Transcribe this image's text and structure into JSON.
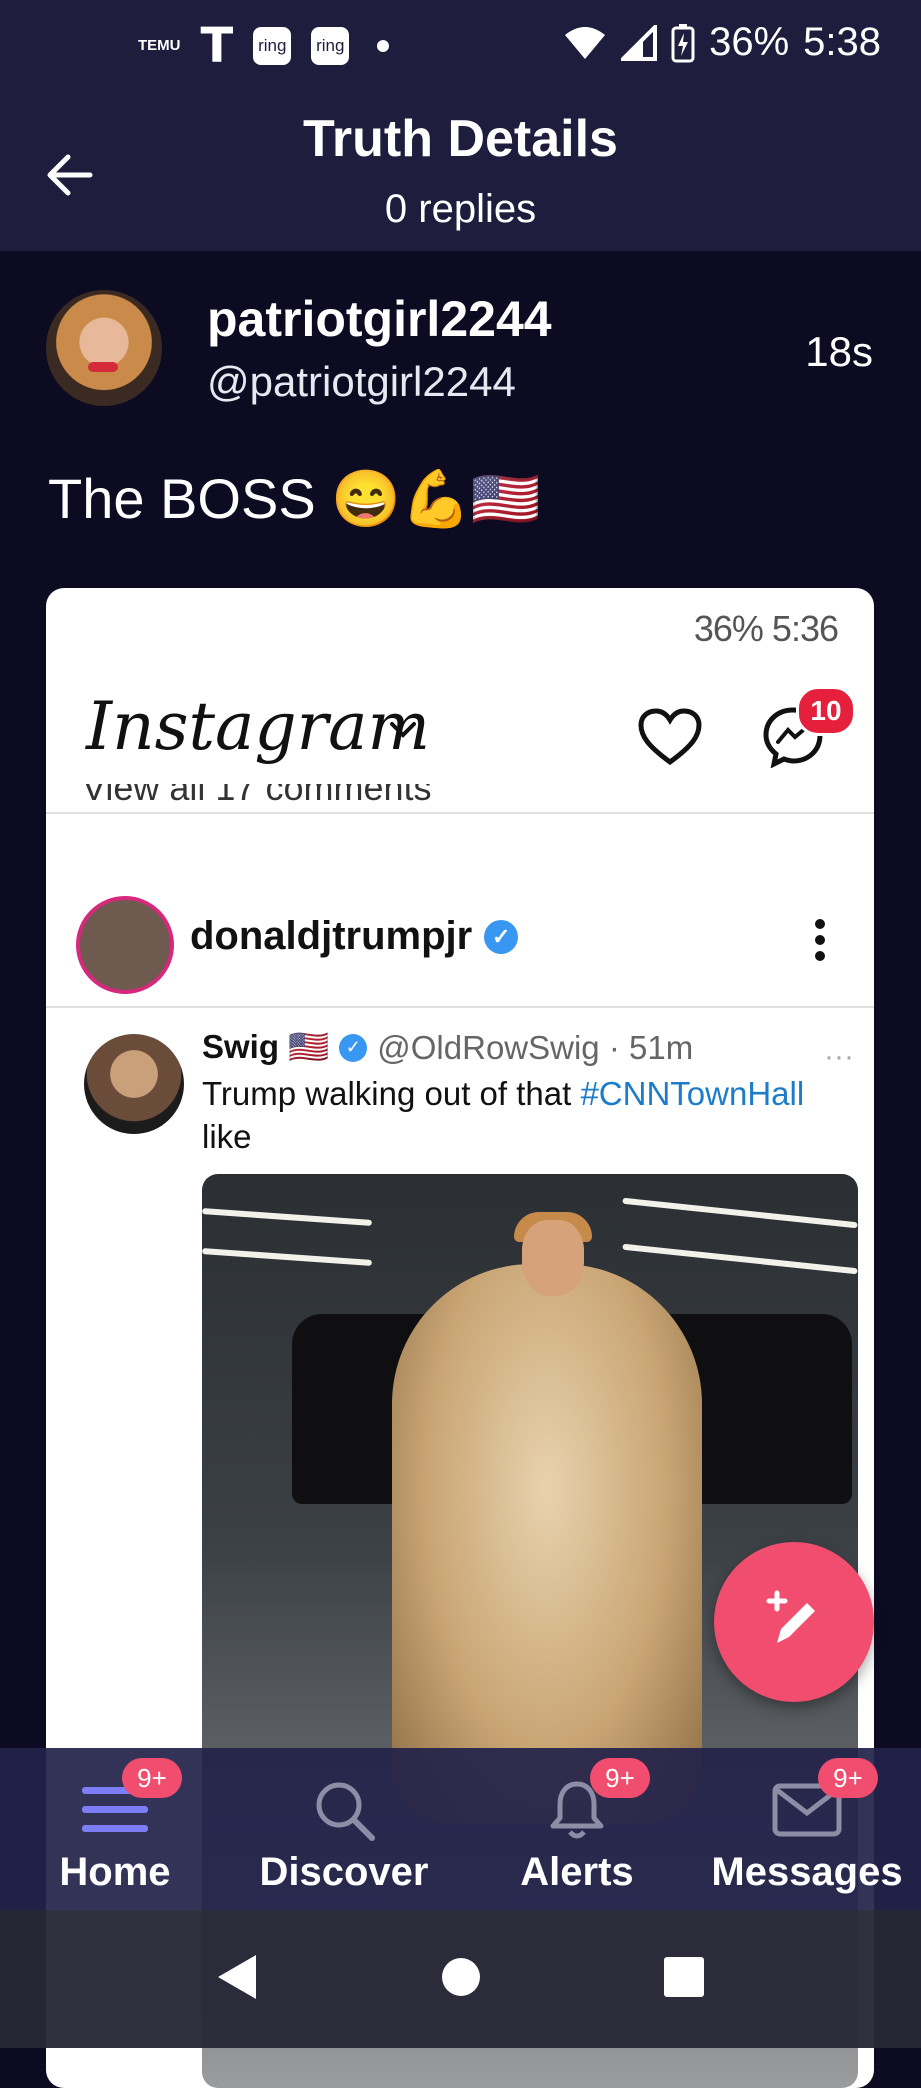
{
  "status_bar": {
    "temu_label": "TEMU",
    "t_logo": "T",
    "ring1": "ring",
    "ring2": "ring",
    "battery": "36%",
    "time": "5:38"
  },
  "header": {
    "title": "Truth Details",
    "subtitle": "0 replies"
  },
  "post": {
    "author_name": "patriotgirl2244",
    "author_handle": "@patriotgirl2244",
    "time_ago": "18s",
    "text": "The BOSS 😄💪🇺🇸"
  },
  "embedded": {
    "status": "36% 5:36",
    "app_name": "Instagram",
    "message_badge": "10",
    "comments_peek": "View all 17 comments",
    "ig_username": "donaldjtrumpjr",
    "tweet": {
      "name": "Swig 🇺🇸",
      "handle_time": "@OldRowSwig · 51m",
      "more": "···",
      "text_before": "Trump walking out of that ",
      "hashtag": "#CNNTownHall",
      "text_after": " like"
    }
  },
  "bottom_nav": {
    "items": [
      {
        "label": "Home",
        "badge": "9+"
      },
      {
        "label": "Discover",
        "badge": ""
      },
      {
        "label": "Alerts",
        "badge": "9+"
      },
      {
        "label": "Messages",
        "badge": "9+"
      }
    ]
  },
  "colors": {
    "background": "#0d0b22",
    "header_bg": "#1e1d3d",
    "accent": "#f04d6f",
    "home_icon": "#7d7ef7"
  }
}
